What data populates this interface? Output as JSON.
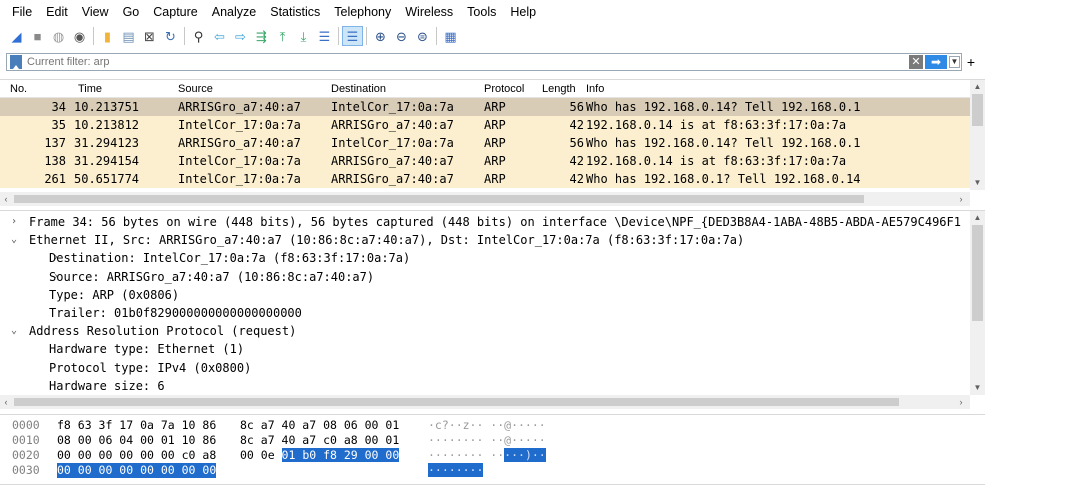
{
  "menubar": {
    "items": [
      "File",
      "Edit",
      "View",
      "Go",
      "Capture",
      "Analyze",
      "Statistics",
      "Telephony",
      "Wireless",
      "Tools",
      "Help"
    ]
  },
  "toolbar": {
    "buttons": [
      {
        "name": "shark-fin-start-icon",
        "glyph": "◢",
        "color": "#2f6fd6"
      },
      {
        "name": "stop-capture-icon",
        "glyph": "■",
        "color": "#8a8a8a"
      },
      {
        "name": "restart-capture-icon",
        "glyph": "◍",
        "color": "#9a9a9a"
      },
      {
        "name": "capture-options-icon",
        "glyph": "◉",
        "color": "#555555"
      },
      {
        "name": "open-file-icon",
        "glyph": "▮",
        "color": "#f0b43a"
      },
      {
        "name": "save-file-icon",
        "glyph": "▤",
        "color": "#6c8fb5"
      },
      {
        "name": "close-file-icon",
        "glyph": "⊠",
        "color": "#444444"
      },
      {
        "name": "reload-file-icon",
        "glyph": "↻",
        "color": "#3b6fb6"
      },
      {
        "name": "find-packet-icon",
        "glyph": "⚲",
        "color": "#333333"
      },
      {
        "name": "go-back-icon",
        "glyph": "⇦",
        "color": "#3aa6d8"
      },
      {
        "name": "go-forward-icon",
        "glyph": "⇨",
        "color": "#3aa6d8"
      },
      {
        "name": "go-to-packet-icon",
        "glyph": "⇶",
        "color": "#3aa66a"
      },
      {
        "name": "go-first-packet-icon",
        "glyph": "⤒",
        "color": "#3aa66a"
      },
      {
        "name": "go-last-packet-icon",
        "glyph": "⤓",
        "color": "#3aa66a"
      },
      {
        "name": "autoscroll-icon",
        "glyph": "☰",
        "color": "#3a6fc6"
      },
      {
        "name": "colorize-icon",
        "glyph": "☰",
        "color": "#3a6fc6",
        "active": true
      },
      {
        "name": "zoom-in-icon",
        "glyph": "⊕",
        "color": "#2a4f8a"
      },
      {
        "name": "zoom-out-icon",
        "glyph": "⊖",
        "color": "#2a4f8a"
      },
      {
        "name": "zoom-normal-icon",
        "glyph": "⊜",
        "color": "#2a4f8a"
      },
      {
        "name": "resize-columns-icon",
        "glyph": "▦",
        "color": "#3a6fc6"
      }
    ]
  },
  "filter": {
    "placeholder": "Current filter: arp",
    "add_label": "+"
  },
  "packet_list": {
    "columns": [
      "No.",
      "Time",
      "Source",
      "Destination",
      "Protocol",
      "Length",
      "Info"
    ],
    "rows": [
      {
        "no": "34",
        "time": "10.213751",
        "source": "ARRISGro_a7:40:a7",
        "destination": "IntelCor_17:0a:7a",
        "protocol": "ARP",
        "length": "56",
        "info": "Who has 192.168.0.14? Tell 192.168.0.1",
        "selected": true
      },
      {
        "no": "35",
        "time": "10.213812",
        "source": "IntelCor_17:0a:7a",
        "destination": "ARRISGro_a7:40:a7",
        "protocol": "ARP",
        "length": "42",
        "info": "192.168.0.14 is at f8:63:3f:17:0a:7a",
        "selected": false
      },
      {
        "no": "137",
        "time": "31.294123",
        "source": "ARRISGro_a7:40:a7",
        "destination": "IntelCor_17:0a:7a",
        "protocol": "ARP",
        "length": "56",
        "info": "Who has 192.168.0.14? Tell 192.168.0.1",
        "selected": false
      },
      {
        "no": "138",
        "time": "31.294154",
        "source": "IntelCor_17:0a:7a",
        "destination": "ARRISGro_a7:40:a7",
        "protocol": "ARP",
        "length": "42",
        "info": "192.168.0.14 is at f8:63:3f:17:0a:7a",
        "selected": false
      },
      {
        "no": "261",
        "time": "50.651774",
        "source": "IntelCor_17:0a:7a",
        "destination": "ARRISGro_a7:40:a7",
        "protocol": "ARP",
        "length": "42",
        "info": "Who has 192.168.0.1? Tell 192.168.0.14",
        "selected": false
      }
    ],
    "row_color": "#fbefcf",
    "selected_color": "#d8ccb6"
  },
  "details": {
    "lines": [
      {
        "indent": 0,
        "arrow": "›",
        "text": "Frame 34: 56 bytes on wire (448 bits), 56 bytes captured (448 bits) on interface \\Device\\NPF_{DED3B8A4-1ABA-48B5-ABDA-AE579C496F1"
      },
      {
        "indent": 0,
        "arrow": "⌄",
        "text": "Ethernet II, Src: ARRISGro_a7:40:a7 (10:86:8c:a7:40:a7), Dst: IntelCor_17:0a:7a (f8:63:3f:17:0a:7a)"
      },
      {
        "indent": 1,
        "arrow": "›",
        "text": "Destination: IntelCor_17:0a:7a (f8:63:3f:17:0a:7a)"
      },
      {
        "indent": 1,
        "arrow": "›",
        "text": "Source: ARRISGro_a7:40:a7 (10:86:8c:a7:40:a7)"
      },
      {
        "indent": 2,
        "arrow": "",
        "text": "Type: ARP (0x0806)"
      },
      {
        "indent": 2,
        "arrow": "",
        "text": "Trailer: 01b0f829000000000000000000"
      },
      {
        "indent": 0,
        "arrow": "⌄",
        "text": "Address Resolution Protocol (request)"
      },
      {
        "indent": 2,
        "arrow": "",
        "text": "Hardware type: Ethernet (1)"
      },
      {
        "indent": 2,
        "arrow": "",
        "text": "Protocol type: IPv4 (0x0800)"
      },
      {
        "indent": 2,
        "arrow": "",
        "text": "Hardware size: 6"
      }
    ]
  },
  "bytes": {
    "rows": [
      {
        "offset": "0000",
        "hex1": "f8 63 3f 17 0a 7a 10 86",
        "hex2": "8c a7 40 a7 08 06 00 01",
        "hex2_hl": "",
        "hex1_full_hl": false,
        "ascii": "·c?··z·· ··@·····",
        "ascii_hl": ""
      },
      {
        "offset": "0010",
        "hex1": "08 00 06 04 00 01 10 86",
        "hex2": "8c a7 40 a7 c0 a8 00 01",
        "hex2_hl": "",
        "hex1_full_hl": false,
        "ascii": "········ ··@·····",
        "ascii_hl": ""
      },
      {
        "offset": "0020",
        "hex1": "00 00 00 00 00 00 c0 a8",
        "hex2": "00 0e ",
        "hex2_hl": "01 b0 f8 29 00 00",
        "hex1_full_hl": false,
        "ascii": "········ ··",
        "ascii_hl": "···)··"
      },
      {
        "offset": "0030",
        "hex1": "00 00 00 00 00 00 00 00",
        "hex2": "",
        "hex2_hl": "",
        "hex1_full_hl": true,
        "ascii": "",
        "ascii_hl": "········"
      }
    ]
  },
  "colors": {
    "accent": "#1f6ccd",
    "apply_button": "#2f8ae6"
  }
}
